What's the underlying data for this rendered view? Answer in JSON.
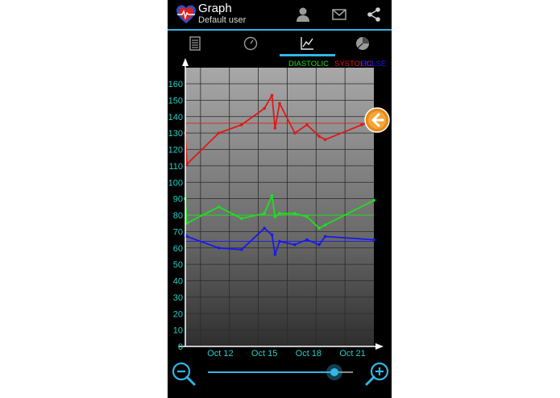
{
  "app": {
    "title": "Graph",
    "subtitle": "Default user",
    "icon": "heart-pulse-icon"
  },
  "actions": [
    {
      "name": "user-icon"
    },
    {
      "name": "mail-icon"
    },
    {
      "name": "share-icon"
    }
  ],
  "tabs": [
    {
      "name": "list-icon",
      "selected": false
    },
    {
      "name": "gauge-icon",
      "selected": false
    },
    {
      "name": "graph-icon",
      "selected": true
    },
    {
      "name": "pie-chart-icon",
      "selected": false
    }
  ],
  "colors": {
    "accent": "#33b5e5",
    "axis_text": "#22d0c8",
    "diastolic": "#22dd22",
    "systolic": "#e01818",
    "pulse": "#1a1ae8"
  },
  "chart_data": {
    "type": "line",
    "legend": [
      "DIASTOLIC",
      "SYSTOLIC",
      "PULSE"
    ],
    "y_ticks": [
      "160",
      "150",
      "140",
      "130",
      "120",
      "110",
      "100",
      "90",
      "80",
      "70",
      "60",
      "50",
      "40",
      "30",
      "20",
      "10",
      "0"
    ],
    "x_ticks": [
      "Oct 12",
      "Oct 15",
      "Oct 18",
      "Oct 21"
    ],
    "ylim": [
      0,
      160
    ],
    "xlim": [
      10.0,
      22.4
    ],
    "series": [
      {
        "name": "SYSTOLIC",
        "color": "#e01818",
        "avg": 136,
        "points": [
          [
            10.0,
            130
          ],
          [
            10.1,
            111
          ],
          [
            12.2,
            130
          ],
          [
            13.7,
            135
          ],
          [
            15.2,
            145
          ],
          [
            15.7,
            153
          ],
          [
            15.9,
            133
          ],
          [
            16.2,
            148
          ],
          [
            17.2,
            130
          ],
          [
            18.0,
            135
          ],
          [
            18.8,
            128
          ],
          [
            19.2,
            126
          ],
          [
            21.6,
            135
          ],
          [
            22.4,
            138
          ]
        ]
      },
      {
        "name": "DIASTOLIC",
        "color": "#22dd22",
        "avg": 80,
        "points": [
          [
            10.0,
            90
          ],
          [
            10.1,
            75
          ],
          [
            12.2,
            85
          ],
          [
            13.7,
            78
          ],
          [
            15.2,
            81
          ],
          [
            15.7,
            92
          ],
          [
            15.9,
            79
          ],
          [
            16.2,
            81
          ],
          [
            17.2,
            81
          ],
          [
            18.0,
            79
          ],
          [
            18.8,
            72
          ],
          [
            19.2,
            74
          ],
          [
            22.4,
            89
          ]
        ]
      },
      {
        "name": "PULSE",
        "color": "#1a1ae8",
        "avg": 64,
        "points": [
          [
            10.0,
            68
          ],
          [
            10.1,
            67
          ],
          [
            12.2,
            60
          ],
          [
            13.7,
            59
          ],
          [
            15.2,
            72
          ],
          [
            15.7,
            68
          ],
          [
            15.9,
            56
          ],
          [
            16.2,
            64
          ],
          [
            17.2,
            62
          ],
          [
            18.0,
            65
          ],
          [
            18.8,
            62
          ],
          [
            19.2,
            67
          ],
          [
            22.4,
            65
          ]
        ]
      }
    ]
  },
  "zoom": {
    "level": 0.87
  }
}
